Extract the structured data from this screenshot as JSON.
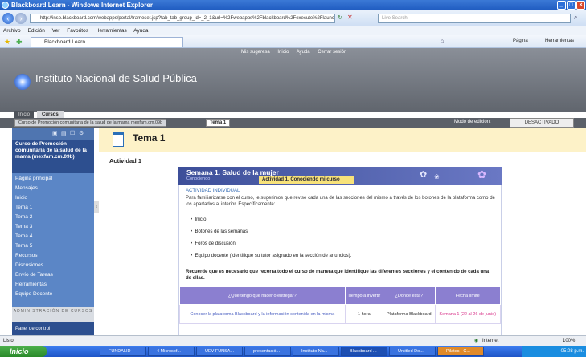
{
  "window": {
    "title": "Blackboard Learn - Windows Internet Explorer"
  },
  "browser": {
    "address": "http://insp.blackboard.com/webapps/portal/frameset.jsp?tab_tab_group_id=_2_1&url=%2Fwebapps%2Fblackboard%2Fexecute%2Flauncher%3Ftype%3DCourse%26id%3D",
    "search_placeholder": "Live Search",
    "menu": [
      "Archivo",
      "Edición",
      "Ver",
      "Favoritos",
      "Herramientas",
      "Ayuda"
    ],
    "tab_title": "Blackboard Learn",
    "page_label": "Página",
    "tools_label": "Herramientas"
  },
  "header": {
    "institution": "Instituto Nacional de Salud Pública",
    "links": [
      "Mis sugeresa",
      "Inicio",
      "Ayuda",
      "Cerrar sesión"
    ],
    "tabs": [
      "Inicio",
      "Cursos"
    ]
  },
  "breadcrumb": {
    "course": "Curso de Promoción comunitaria de la salud de la mama mexfam.cm.09b",
    "current": "Tema 1",
    "edit_mode_label": "Modo de edición:",
    "edit_mode_value": "DESACTIVADO"
  },
  "sidebar": {
    "course_title": "Curso de Promoción comunitaria de la salud de la mama (mexfam.cm.09b)",
    "items": [
      "Página principal",
      "Mensajes",
      "Inicio",
      "Tema 1",
      "Tema 2",
      "Tema 3",
      "Tema 4",
      "Tema 5",
      "Recursos",
      "Discusiones",
      "Envío de Tareas",
      "Herramientas",
      "Equipo Docente"
    ],
    "admin_header": "ADMINISTRACIÓN DE CURSOS",
    "panel_link": "Panel de control"
  },
  "main": {
    "title": "Tema 1",
    "activity": "Actividad 1",
    "banner_title": "Semana 1. Salud de la mujer",
    "banner_small": "Conociendo",
    "banner_tag": "Actividad 1. Conociendo mi curso",
    "section_header": "ACTIVIDAD INDIVIDUAL",
    "intro": "Para familiarizarse con el curso, le sugerimos que revise cada una de las secciones del mismo a través de los botones de la plataforma como de los apartados al interior. Específicamente:",
    "bullets": [
      "Inicio",
      "Botones de las semanas",
      "Foros de discusión",
      "Equipo docente (identifique su tutor asignado en la sección de anuncios)."
    ],
    "recuerde": "Recuerde que es necesario que recorra todo el curso de manera que identifique las diferentes secciones y el contenido de cada una de ellas.",
    "table_headers": [
      "¿Qué tengo que hacer o entregar?",
      "Tiempo a invertir",
      "¿Dónde está?",
      "Fecha límite"
    ],
    "table_row": [
      "Conocer la plataforma Blackboard y la información contenida en la misma",
      "1 hora",
      "Plataforma Blackboard",
      "Semana 1 (22 al 26 de junio)"
    ]
  },
  "statusbar": {
    "left": "Listo",
    "zone": "Internet",
    "zoom": "100%"
  },
  "taskbar": {
    "start": "Inicio",
    "buttons": [
      "FUNDALID",
      "4 Microsof...",
      "UEV-FUNSA...",
      "presentació...",
      "Instituto Na...",
      "Blackboard ...",
      "Untitled Do...",
      "Pilates - C..."
    ],
    "clock": "05:08 p.m."
  }
}
